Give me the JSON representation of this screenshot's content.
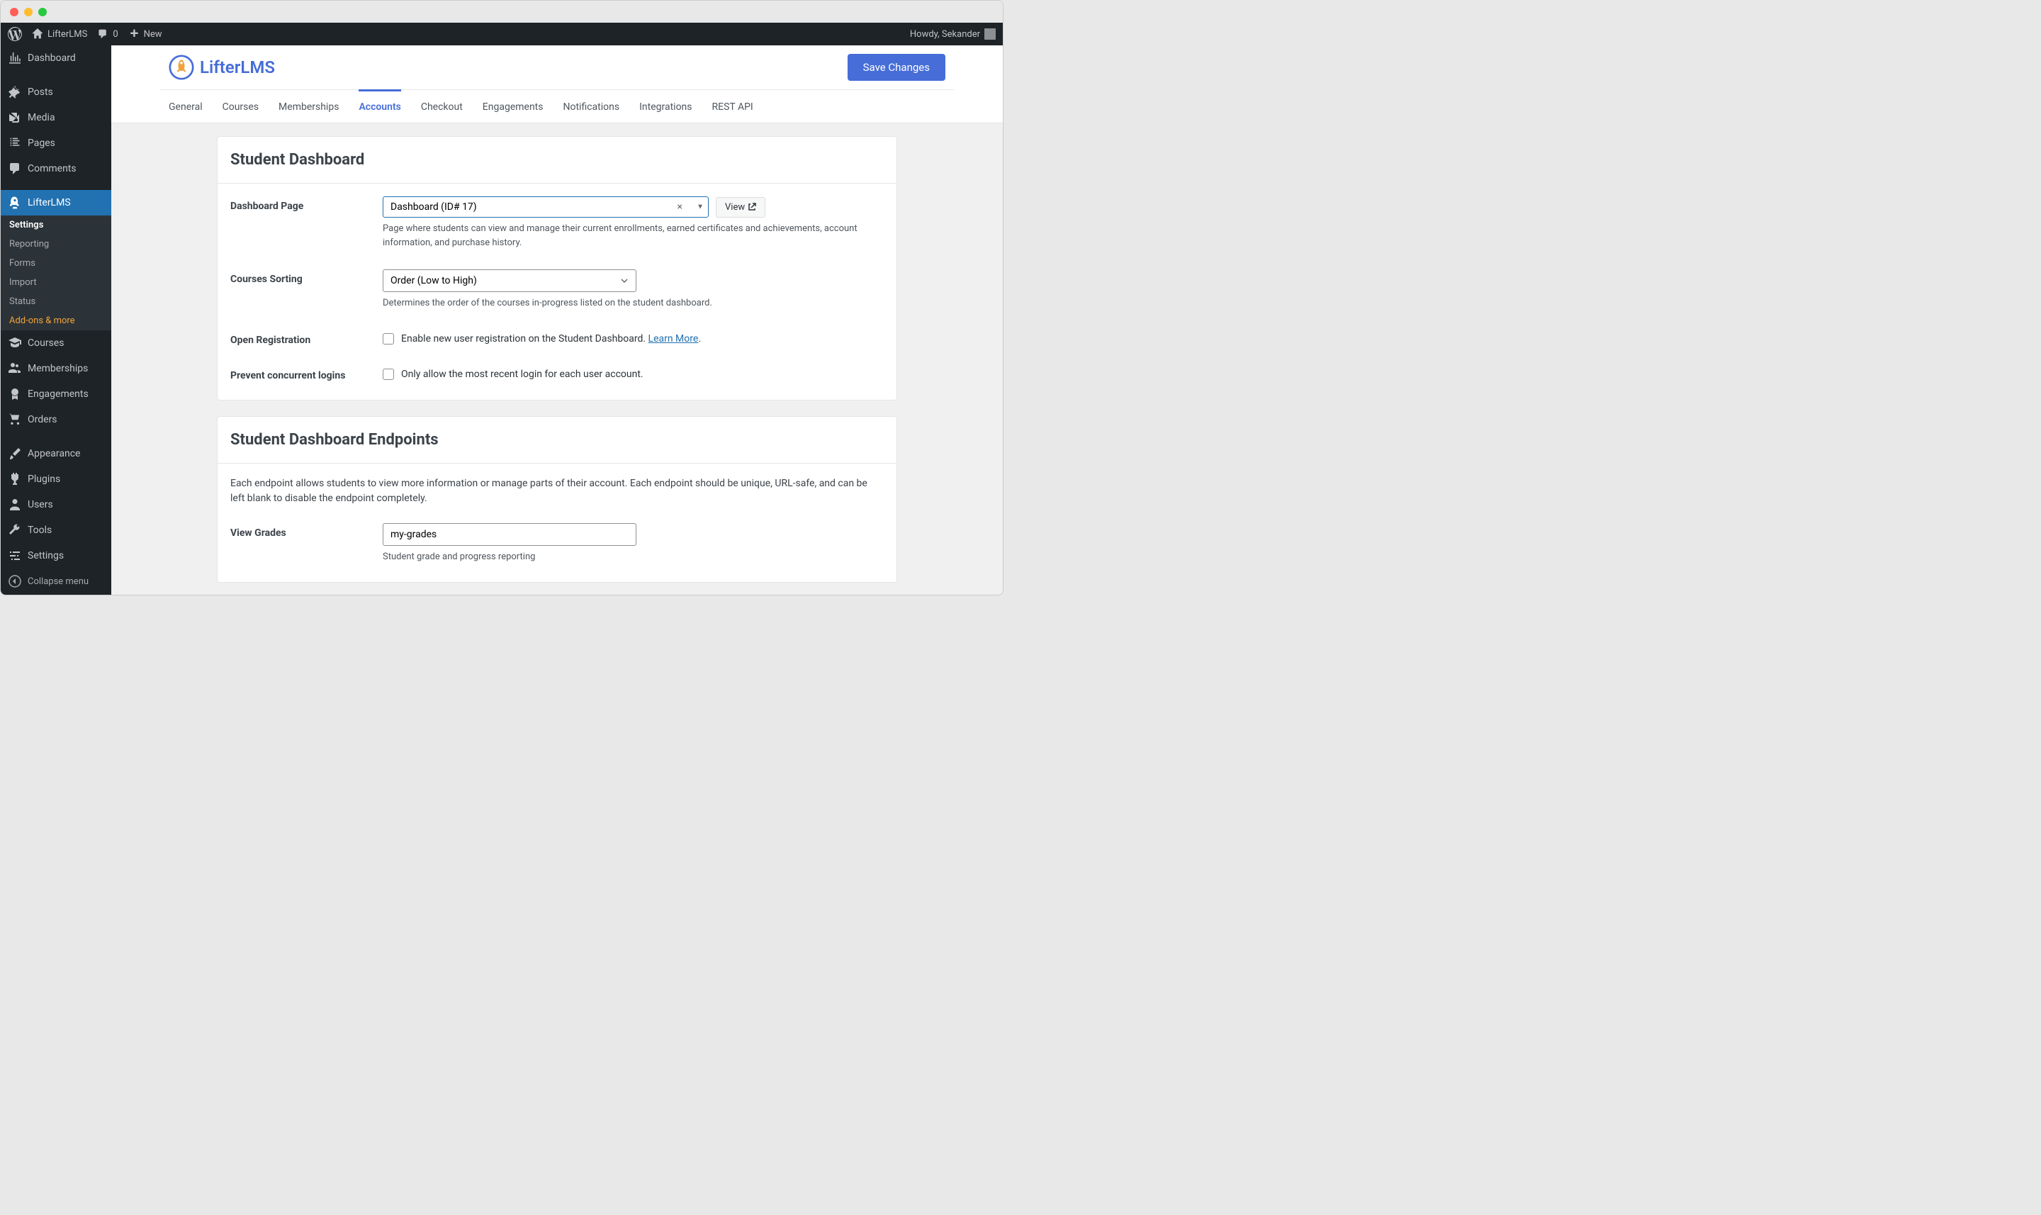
{
  "adminbar": {
    "site_name": "LifterLMS",
    "comments_count": "0",
    "new_label": "New",
    "howdy": "Howdy, Sekander"
  },
  "sidebar": {
    "dashboard": "Dashboard",
    "posts": "Posts",
    "media": "Media",
    "pages": "Pages",
    "comments": "Comments",
    "lifterlms": "LifterLMS",
    "submenu": {
      "settings": "Settings",
      "reporting": "Reporting",
      "forms": "Forms",
      "import": "Import",
      "status": "Status",
      "addons": "Add-ons & more"
    },
    "courses": "Courses",
    "memberships": "Memberships",
    "engagements": "Engagements",
    "orders": "Orders",
    "appearance": "Appearance",
    "plugins": "Plugins",
    "users": "Users",
    "tools": "Tools",
    "settings": "Settings",
    "collapse": "Collapse menu"
  },
  "header": {
    "logo_text": "LifterLMS",
    "save_button": "Save Changes"
  },
  "tabs": [
    {
      "label": "General",
      "active": false
    },
    {
      "label": "Courses",
      "active": false
    },
    {
      "label": "Memberships",
      "active": false
    },
    {
      "label": "Accounts",
      "active": true
    },
    {
      "label": "Checkout",
      "active": false
    },
    {
      "label": "Engagements",
      "active": false
    },
    {
      "label": "Notifications",
      "active": false
    },
    {
      "label": "Integrations",
      "active": false
    },
    {
      "label": "REST API",
      "active": false
    }
  ],
  "panel1": {
    "title": "Student Dashboard",
    "dashboard_page": {
      "label": "Dashboard Page",
      "value": "Dashboard (ID# 17)",
      "desc": "Page where students can view and manage their current enrollments, earned certificates and achievements, account information, and purchase history.",
      "view_btn": "View"
    },
    "courses_sorting": {
      "label": "Courses Sorting",
      "value": "Order (Low to High)",
      "desc": "Determines the order of the courses in-progress listed on the student dashboard."
    },
    "open_registration": {
      "label": "Open Registration",
      "text": "Enable new user registration on the Student Dashboard. ",
      "learn_more": "Learn More",
      "period": "."
    },
    "prevent_concurrent": {
      "label": "Prevent concurrent logins",
      "text": "Only allow the most recent login for each user account."
    }
  },
  "panel2": {
    "title": "Student Dashboard Endpoints",
    "desc": "Each endpoint allows students to view more information or manage parts of their account. Each endpoint should be unique, URL-safe, and can be left blank to disable the endpoint completely.",
    "view_grades": {
      "label": "View Grades",
      "value": "my-grades",
      "desc": "Student grade and progress reporting"
    }
  }
}
